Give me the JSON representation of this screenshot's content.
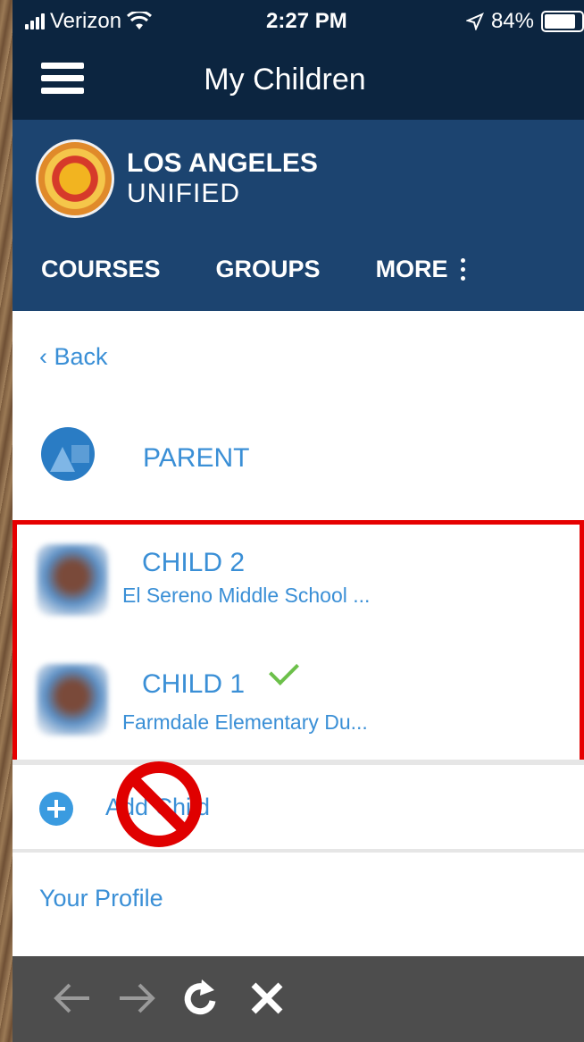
{
  "status_bar": {
    "carrier": "Verizon",
    "time": "2:27 PM",
    "battery": "84%",
    "icons": [
      "signal-icon",
      "wifi-icon",
      "location-icon",
      "battery-icon"
    ]
  },
  "header": {
    "title": "My Children",
    "menu_icon": "hamburger-icon"
  },
  "district": {
    "name_line1": "LOS ANGELES",
    "name_line2": "UNIFIED",
    "tabs": [
      {
        "label": "COURSES"
      },
      {
        "label": "GROUPS"
      },
      {
        "label": "MORE"
      }
    ]
  },
  "nav": {
    "back_label": "Back"
  },
  "parent": {
    "label": "PARENT"
  },
  "children": [
    {
      "name": "CHILD 2",
      "school": "El Sereno Middle School ...",
      "selected": false
    },
    {
      "name": "CHILD 1",
      "school": "Farmdale Elementary Du...",
      "selected": true
    }
  ],
  "actions": {
    "add_child_label": "Add Child",
    "profile_label": "Your Profile"
  },
  "colors": {
    "nav_dark": "#0c2540",
    "district_blue": "#1c4470",
    "link_blue": "#3a8fd6",
    "highlight_red": "#e60000",
    "check_green": "#6cc04a"
  }
}
